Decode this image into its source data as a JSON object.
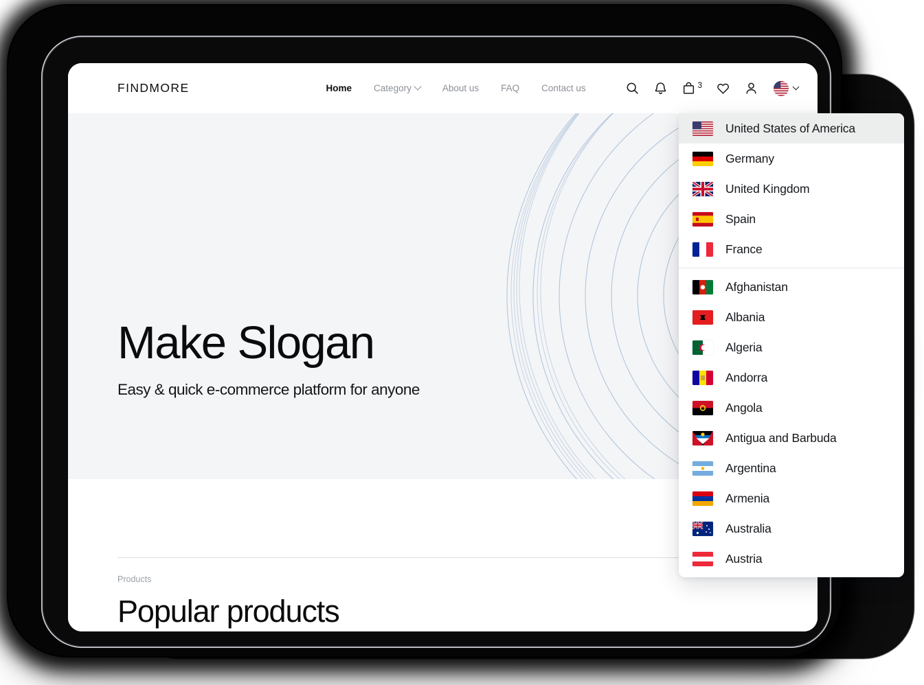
{
  "site": {
    "brand": "FINDMORE",
    "nav": [
      {
        "label": "Home",
        "active": true,
        "caret": false
      },
      {
        "label": "Category",
        "active": false,
        "caret": true
      },
      {
        "label": "About us",
        "active": false,
        "caret": false
      },
      {
        "label": "FAQ",
        "active": false,
        "caret": false
      },
      {
        "label": "Contact us",
        "active": false,
        "caret": false
      }
    ],
    "icons": {
      "search": "search-icon",
      "notification": "bell-icon",
      "cart": "shopping-bag-icon",
      "cart_count": "3",
      "wishlist": "heart-icon",
      "account": "user-icon",
      "language": "us-flag-circle-icon",
      "language_caret": "chevron-down-icon"
    }
  },
  "hero": {
    "title": "Make Slogan",
    "subtitle": "Easy & quick e-commerce platform for anyone",
    "cta_label": "",
    "background_color": "#f4f5f7",
    "ring_color": "#a9c2dc"
  },
  "products_section": {
    "eyebrow": "Products",
    "title": "Popular products"
  },
  "country_dropdown": {
    "selected": "United States of  America",
    "primary": [
      {
        "name": "United States of  America",
        "flag": "us",
        "selected": true
      },
      {
        "name": "Germany",
        "flag": "de",
        "selected": false
      },
      {
        "name": "United Kingdom",
        "flag": "gb",
        "selected": false
      },
      {
        "name": "Spain",
        "flag": "es",
        "selected": false
      },
      {
        "name": "France",
        "flag": "fr",
        "selected": false
      }
    ],
    "all": [
      {
        "name": "Afghanistan",
        "flag": "af"
      },
      {
        "name": "Albania",
        "flag": "al"
      },
      {
        "name": "Algeria",
        "flag": "dz"
      },
      {
        "name": "Andorra",
        "flag": "ad"
      },
      {
        "name": "Angola",
        "flag": "ao"
      },
      {
        "name": "Antigua and Barbuda",
        "flag": "ag"
      },
      {
        "name": "Argentina",
        "flag": "ar"
      },
      {
        "name": "Armenia",
        "flag": "am"
      },
      {
        "name": "Australia",
        "flag": "au"
      },
      {
        "name": "Austria",
        "flag": "at"
      }
    ]
  },
  "theme": {
    "accent_dark": "#0a0b0c",
    "muted_text": "#8b9097",
    "hero_bg": "#f4f5f7",
    "selected_row_bg": "#eceded",
    "device_bezel": "#050506"
  }
}
